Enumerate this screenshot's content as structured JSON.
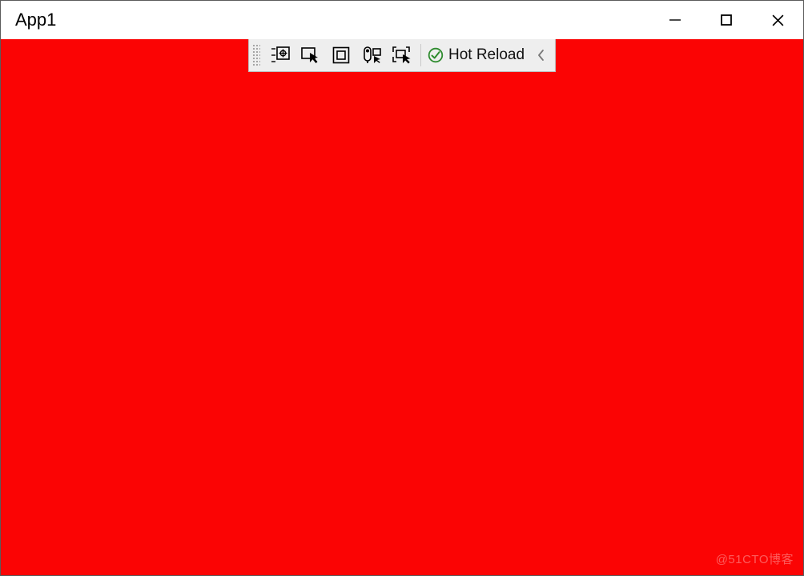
{
  "window": {
    "title": "App1"
  },
  "client": {
    "background": "#fb0404"
  },
  "debug_toolbar": {
    "icons": [
      "live-visual-tree-icon",
      "select-element-icon",
      "display-layout-adorners-icon",
      "track-focused-element-icon",
      "go-to-live-visual-tree-icon"
    ],
    "hot_reload_label": "Hot Reload"
  },
  "watermark": "@51CTO博客"
}
